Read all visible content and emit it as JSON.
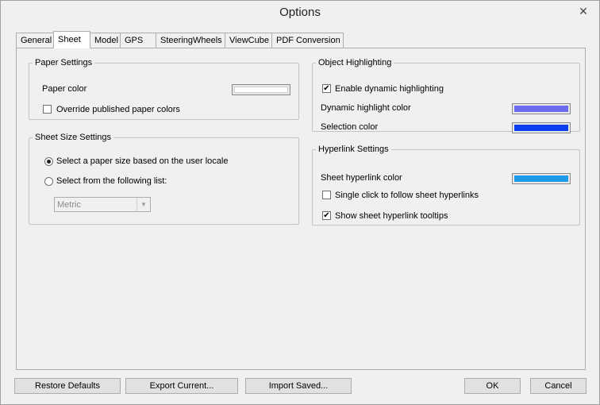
{
  "window": {
    "title": "Options",
    "close_glyph": "✕"
  },
  "tabs": [
    {
      "label": "General"
    },
    {
      "label": "Sheet",
      "active": true
    },
    {
      "label": "Model"
    },
    {
      "label": "GPS"
    },
    {
      "label": "SteeringWheels"
    },
    {
      "label": "ViewCube"
    },
    {
      "label": "PDF Conversion"
    }
  ],
  "paper_settings": {
    "title": "Paper Settings",
    "paper_color_label": "Paper color",
    "paper_color": "#ffffff",
    "override_label": "Override published paper colors",
    "override_checked": false
  },
  "sheet_size": {
    "title": "Sheet Size Settings",
    "locale_label": "Select a paper size based on the user locale",
    "list_label": "Select from the following list:",
    "selected_option": "locale",
    "dropdown_value": "Metric"
  },
  "object_highlighting": {
    "title": "Object Highlighting",
    "enable_label": "Enable dynamic highlighting",
    "enable_checked": true,
    "dynamic_label": "Dynamic highlight color",
    "dynamic_color": "#6b6bf2",
    "selection_label": "Selection color",
    "selection_color": "#0b3ff0"
  },
  "hyperlink": {
    "title": "Hyperlink Settings",
    "color_label": "Sheet hyperlink color",
    "color": "#1e9be8",
    "single_click_label": "Single click to follow sheet hyperlinks",
    "single_click_checked": false,
    "tooltips_label": "Show sheet hyperlink tooltips",
    "tooltips_checked": true
  },
  "buttons": {
    "restore": "Restore Defaults",
    "export": "Export Current...",
    "import": "Import Saved...",
    "ok": "OK",
    "cancel": "Cancel"
  },
  "check_glyph": "✔"
}
